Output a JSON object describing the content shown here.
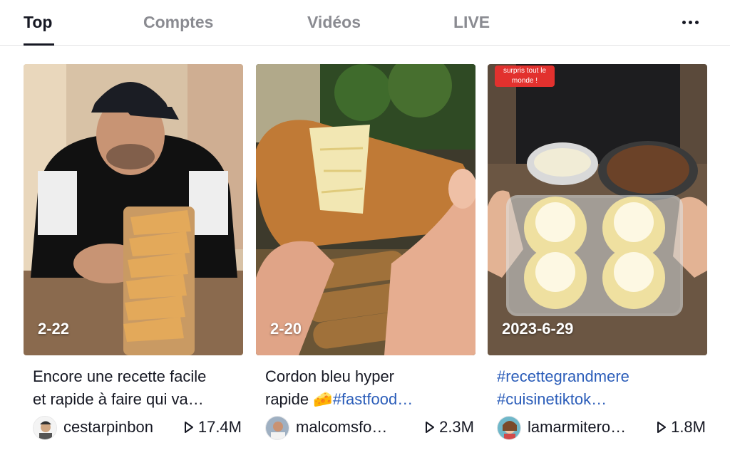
{
  "tabs": [
    {
      "label": "Top",
      "active": true
    },
    {
      "label": "Comptes",
      "active": false
    },
    {
      "label": "Vidéos",
      "active": false
    },
    {
      "label": "LIVE",
      "active": false
    }
  ],
  "more_icon": "more-horizontal-icon",
  "videos": [
    {
      "date": "2-22",
      "desc_line1": "Encore une recette facile",
      "desc_line2": "et rapide à faire qui va…",
      "username": "cestarpinbon",
      "views": "17.4M"
    },
    {
      "date": "2-20",
      "desc_line1": "Cordon bleu hyper",
      "desc_line2_text": "rapide ",
      "desc_line2_emoji": "🧀",
      "desc_line2_tag": "#fastfood…",
      "username": "malcomsfo…",
      "views": "2.3M"
    },
    {
      "date": "2023-6-29",
      "sticker": "surpris tout le monde !",
      "desc_line1": "#recettegrandmere",
      "desc_line2": "#cuisinetiktok…",
      "username": "lamarmitero…",
      "views": "1.8M"
    }
  ],
  "colors": {
    "hashtag": "#2b5db9",
    "text": "#161823",
    "muted": "#8a8b91"
  }
}
